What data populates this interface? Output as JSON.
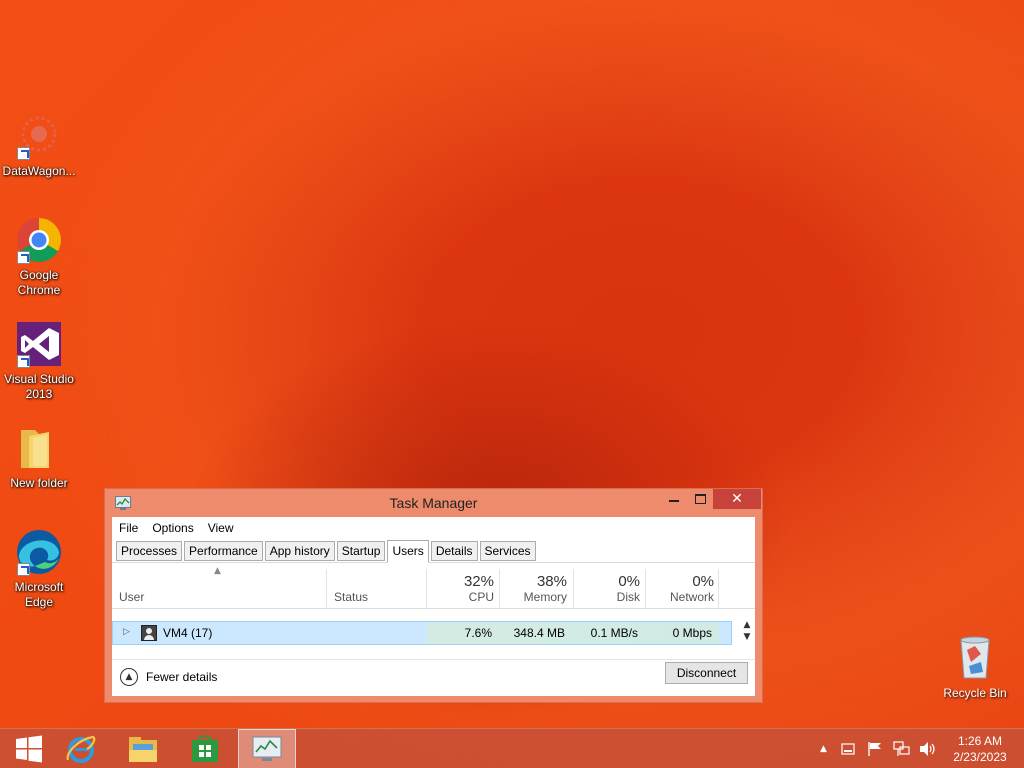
{
  "desktop": {
    "icons": [
      {
        "label": "DataWagon...",
        "icon": "datawagon-icon"
      },
      {
        "label": "Google\nChrome",
        "icon": "chrome-icon"
      },
      {
        "label": "Visual Studio\n2013",
        "icon": "visual-studio-icon"
      },
      {
        "label": "New folder",
        "icon": "folder-icon"
      },
      {
        "label": "Microsoft\nEdge",
        "icon": "edge-icon"
      }
    ],
    "recycle_bin": {
      "label": "Recycle Bin",
      "icon": "recycle-bin-icon"
    }
  },
  "task_manager": {
    "title": "Task Manager",
    "menu": [
      "File",
      "Options",
      "View"
    ],
    "tabs": [
      "Processes",
      "Performance",
      "App history",
      "Startup",
      "Users",
      "Details",
      "Services"
    ],
    "active_tab": "Users",
    "columns": {
      "user": "User",
      "status": "Status",
      "cpu": {
        "pct": "32%",
        "label": "CPU"
      },
      "memory": {
        "pct": "38%",
        "label": "Memory"
      },
      "disk": {
        "pct": "0%",
        "label": "Disk"
      },
      "network": {
        "pct": "0%",
        "label": "Network"
      }
    },
    "rows": [
      {
        "user": "VM4 (17)",
        "status": "",
        "cpu": "7.6%",
        "memory": "348.4 MB",
        "disk": "0.1 MB/s",
        "network": "0 Mbps"
      }
    ],
    "footer": {
      "fewer_details": "Fewer details",
      "disconnect": "Disconnect"
    }
  },
  "taskbar": {
    "items": [
      "start-icon",
      "internet-explorer-icon",
      "file-explorer-icon",
      "store-icon",
      "task-manager-icon"
    ],
    "clock": {
      "time": "1:26 AM",
      "date": "2/23/2023"
    }
  },
  "colors": {
    "accent_window": "#ee8b6c",
    "close_button": "#c7423a",
    "selection": "#cce8ff"
  }
}
